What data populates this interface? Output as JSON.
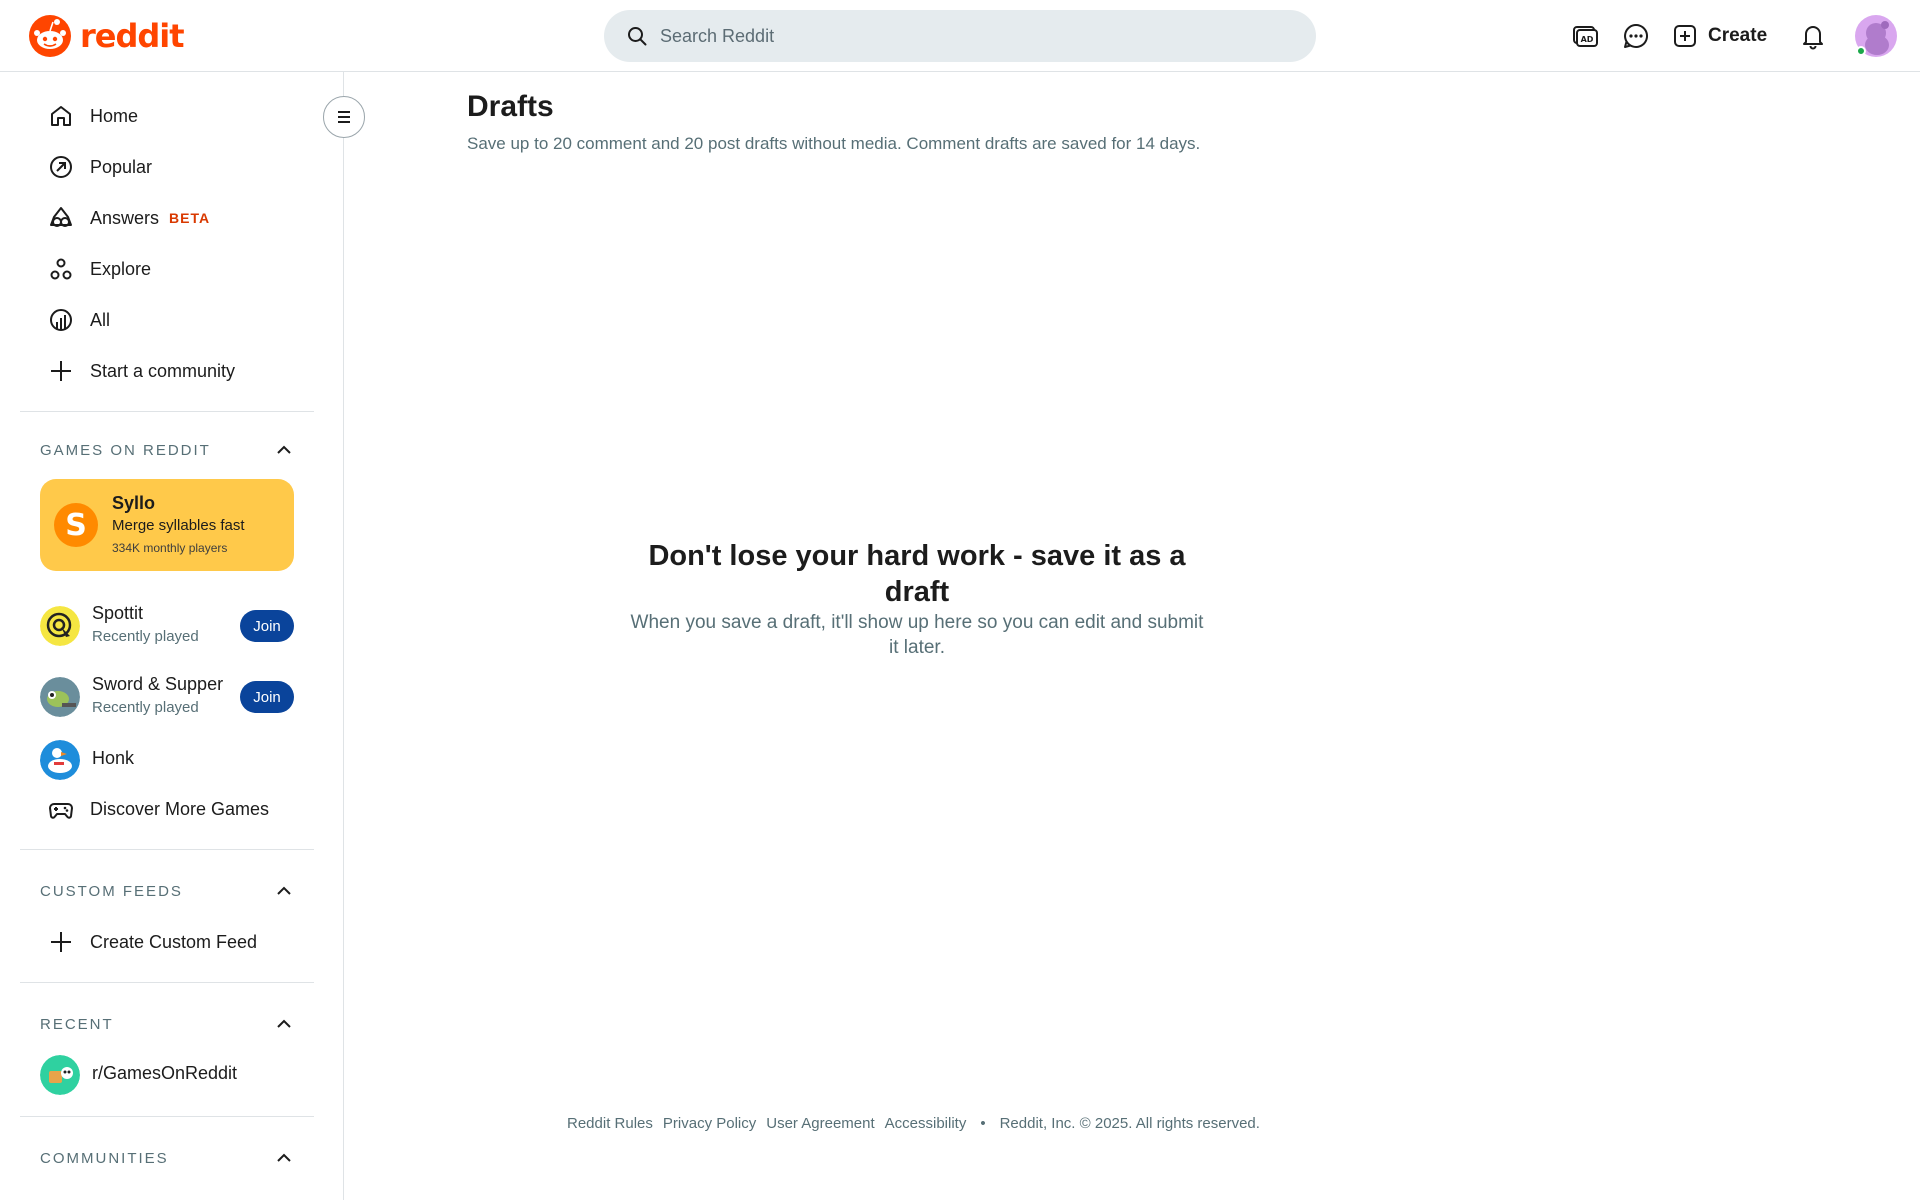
{
  "header": {
    "brand": "reddit",
    "search_placeholder": "Search Reddit",
    "create_label": "Create"
  },
  "sidebar": {
    "nav": [
      {
        "label": "Home",
        "icon": "home-icon"
      },
      {
        "label": "Popular",
        "icon": "popular-icon"
      },
      {
        "label": "Answers",
        "icon": "answers-icon",
        "badge": "BETA"
      },
      {
        "label": "Explore",
        "icon": "explore-icon"
      },
      {
        "label": "All",
        "icon": "all-icon"
      },
      {
        "label": "Start a community",
        "icon": "plus-icon"
      }
    ],
    "games": {
      "title": "GAMES ON REDDIT",
      "featured": {
        "name": "Syllo",
        "tagline": "Merge syllables fast",
        "players": "334K monthly players"
      },
      "items": [
        {
          "name": "Spottit",
          "meta": "Recently played",
          "action": "Join"
        },
        {
          "name": "Sword & Supper",
          "meta": "Recently played",
          "action": "Join"
        },
        {
          "name": "Honk"
        }
      ],
      "discover": "Discover More Games"
    },
    "custom_feeds": {
      "title": "CUSTOM FEEDS",
      "create": "Create Custom Feed"
    },
    "recent": {
      "title": "RECENT",
      "items": [
        "r/GamesOnReddit"
      ]
    },
    "communities": {
      "title": "COMMUNITIES"
    }
  },
  "main": {
    "title": "Drafts",
    "description": "Save up to 20 comment and 20 post drafts without media. Comment drafts are saved for 14 days.",
    "empty_title": "Don't lose your hard work - save it as a draft",
    "empty_subtitle": "When you save a draft, it'll show up here so you can edit and submit it later."
  },
  "footer": {
    "links": [
      "Reddit Rules",
      "Privacy Policy",
      "User Agreement",
      "Accessibility"
    ],
    "separator": "•",
    "copyright": "Reddit, Inc. © 2025. All rights reserved."
  },
  "colors": {
    "brand": "#ff4500",
    "join_button": "#0a449b",
    "featured_card": "#ffc94a",
    "beta_badge": "#d93900"
  }
}
